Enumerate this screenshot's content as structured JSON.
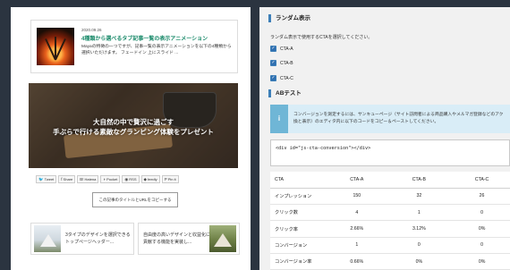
{
  "left": {
    "card": {
      "date": "2020.09.26",
      "title": "4種類から選べるタブ記事一覧の表示アニメーション",
      "excerpt": "Mayaの特徴の一つですが、記事一覧の表示アニメーションを以下の4種類から選択いただけます。 フェードイン 上にスライド ..."
    },
    "banner": {
      "line1": "大自然の中で贅沢に過ごす",
      "line2": "手ぶらで行ける素敵なグランピング体験をプレゼント"
    },
    "share": [
      {
        "icon": "twitter-icon",
        "glyph": "🐦",
        "label": "Tweet"
      },
      {
        "icon": "facebook-icon",
        "glyph": "f",
        "label": "Share"
      },
      {
        "icon": "hatena-icon",
        "glyph": "B!",
        "label": "Hatena"
      },
      {
        "icon": "pocket-icon",
        "glyph": "◗",
        "label": "Pocket"
      },
      {
        "icon": "rss-icon",
        "glyph": "◉",
        "label": "RSS"
      },
      {
        "icon": "feedly-icon",
        "glyph": "◆",
        "label": "feedly"
      },
      {
        "icon": "pinterest-icon",
        "glyph": "P",
        "label": "Pin it"
      }
    ],
    "copy_button": "この記事のタイトルとURLをコピーする",
    "related": [
      {
        "text": "3タイプのデザインを選択できるトップページヘッダー..."
      },
      {
        "text": "自由度の高いデザインと収益化に貢献する機能を実装し..."
      }
    ]
  },
  "right": {
    "random": {
      "heading": "ランダム表示",
      "description": "ランダム表示で使用するCTAを選択してください。",
      "options": [
        {
          "label": "CTA-A",
          "checked": true
        },
        {
          "label": "CTA-B",
          "checked": true
        },
        {
          "label": "CTA-C",
          "checked": true
        }
      ]
    },
    "ab": {
      "heading": "ABテスト",
      "info_line1": "コンバージョンを測定するには、サンキューページ（サイト訪問者による商品購入やメルマガ登録などのアク",
      "info_line2": "換と表示）のエディタ内に以下のコードをコピー＆ペーストしてください。",
      "code": "<div id=\"js-cta-conversion\"></div>",
      "table": {
        "headers": [
          "CTA",
          "CTA-A",
          "CTA-B",
          "CTA-C"
        ],
        "rows": [
          [
            "インプレッション",
            "150",
            "32",
            "26"
          ],
          [
            "クリック数",
            "4",
            "1",
            "0"
          ],
          [
            "クリック率",
            "2.66%",
            "3.12%",
            "0%"
          ],
          [
            "コンバージョン",
            "1",
            "0",
            "0"
          ],
          [
            "コンバージョン率",
            "0.66%",
            "0%",
            "0%"
          ]
        ]
      }
    }
  }
}
